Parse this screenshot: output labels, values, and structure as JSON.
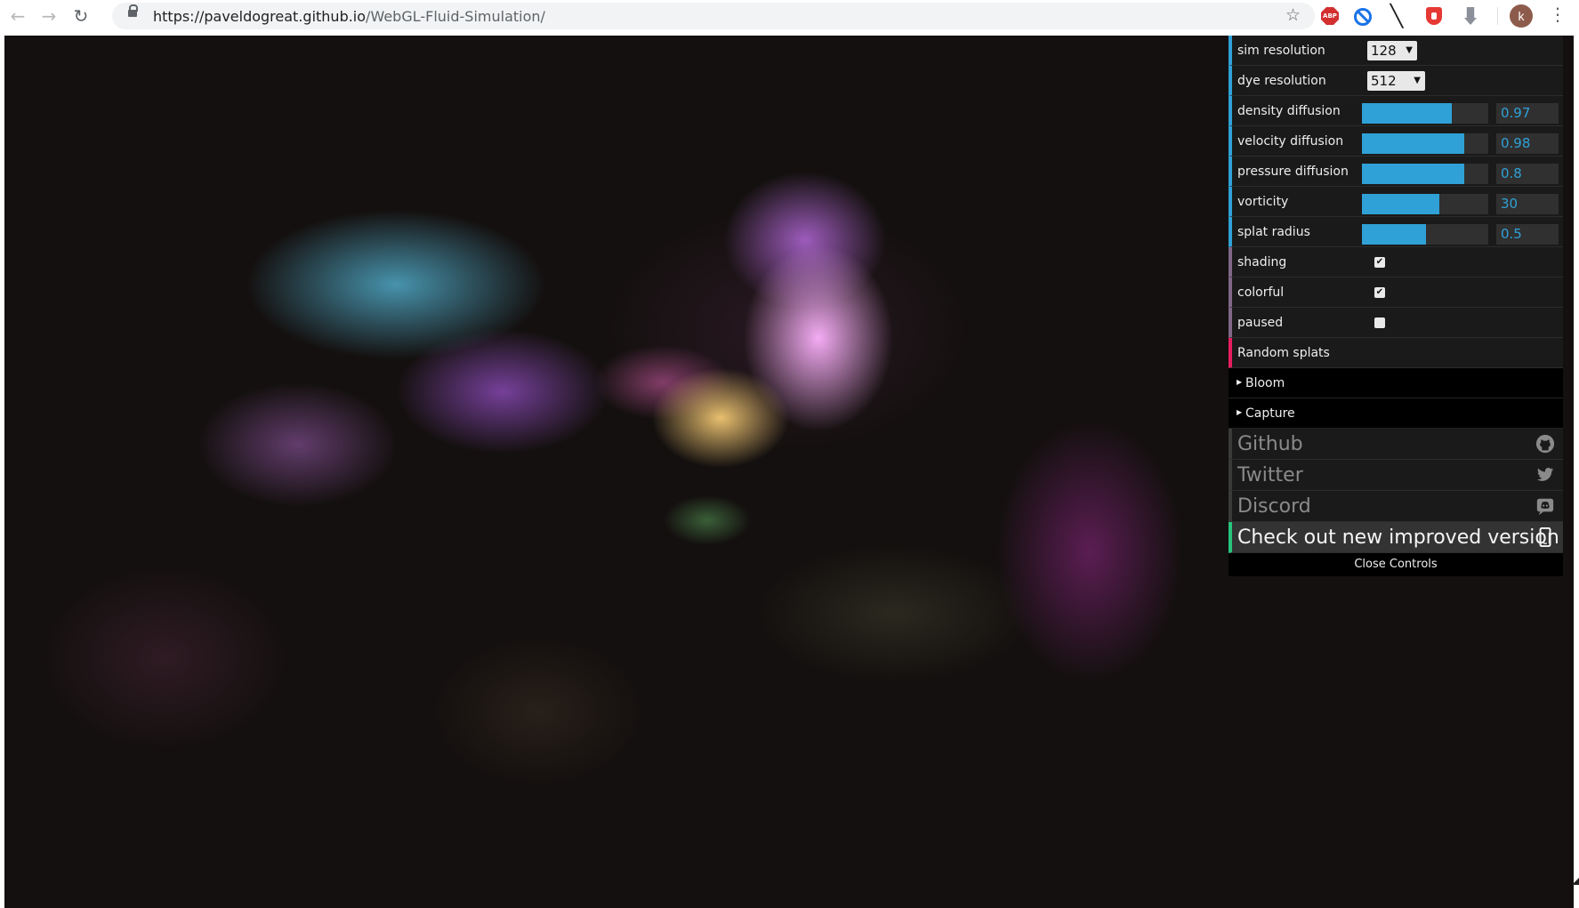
{
  "browser": {
    "url_host": "https://paveldogreat.github.io",
    "url_path": "/WebGL-Fluid-Simulation/",
    "avatar_letter": "k",
    "extensions": [
      "adblock-plus-icon",
      "blocker-icon",
      "slash-icon",
      "shield-extension-icon",
      "download-extension-icon"
    ],
    "extension_abp_text": "ABP"
  },
  "gui": {
    "sim_resolution": {
      "label": "sim resolution",
      "value": "128"
    },
    "dye_resolution": {
      "label": "dye resolution",
      "value": "512"
    },
    "sliders": [
      {
        "label": "density diffusion",
        "value": "0.97",
        "fill": 0.71
      },
      {
        "label": "velocity diffusion",
        "value": "0.98",
        "fill": 0.81
      },
      {
        "label": "pressure diffusion",
        "value": "0.8",
        "fill": 0.81
      },
      {
        "label": "vorticity",
        "value": "30",
        "fill": 0.61
      },
      {
        "label": "splat radius",
        "value": "0.5",
        "fill": 0.51
      }
    ],
    "checkboxes": [
      {
        "label": "shading",
        "checked": true
      },
      {
        "label": "colorful",
        "checked": true
      },
      {
        "label": "paused",
        "checked": false
      }
    ],
    "random_splats": "Random splats",
    "folders": [
      "Bloom",
      "Capture"
    ],
    "links": [
      {
        "label": "Github",
        "icon": "github-icon"
      },
      {
        "label": "Twitter",
        "icon": "twitter-icon"
      },
      {
        "label": "Discord",
        "icon": "discord-icon"
      }
    ],
    "promo": {
      "label": "Check out new improved version",
      "icon": "mobile-phone-icon"
    },
    "close": "Close Controls"
  },
  "colors": {
    "gui_accent": "#2fa1d6",
    "function_accent": "#e61d5f",
    "promo_accent": "#27c47d"
  }
}
